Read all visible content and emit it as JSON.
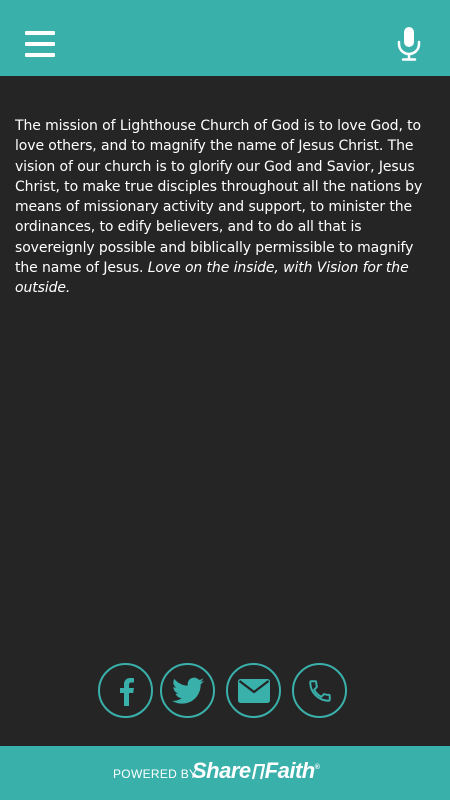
{
  "header": {
    "background_color": "#3ab0ab",
    "menu_icon": "hamburger-menu-icon",
    "mic_icon": "microphone-icon"
  },
  "mission": {
    "text": "The mission of Lighthouse Church of God is to love God, to love others, and to magnify the name of Jesus Christ. The vision of our church is to glorify our God and Savior, Jesus Christ, to make true disciples throughout all the nations by means of missionary activity and support, to minister the ordinances, to edify believers, and to do all that is sovereignly possible and biblically permissible to magnify the name of Jesus.",
    "tagline": "Love on the inside, with Vision for the outside."
  },
  "social": [
    {
      "name": "facebook",
      "icon": "facebook-icon"
    },
    {
      "name": "twitter",
      "icon": "twitter-icon"
    },
    {
      "name": "email",
      "icon": "envelope-icon"
    },
    {
      "name": "phone",
      "icon": "phone-icon"
    }
  ],
  "footer": {
    "powered_by": "POWERED BY",
    "brand_left": "Share",
    "brand_right": "Faith",
    "trademark": "®"
  },
  "colors": {
    "accent": "#3ab0ab",
    "background": "#252525",
    "text": "#ffffff"
  }
}
